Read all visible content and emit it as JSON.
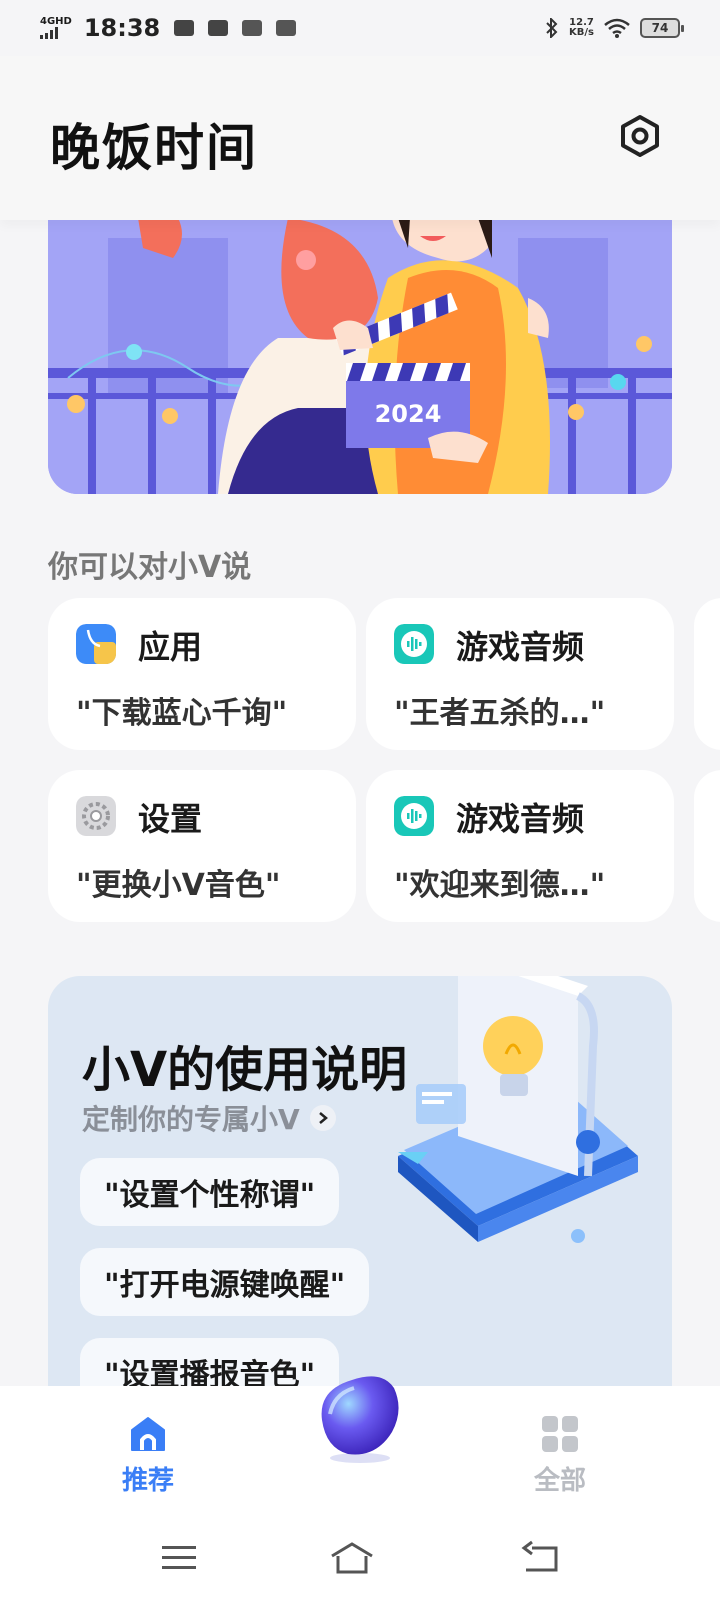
{
  "status_bar": {
    "network": "4GHD",
    "time": "18:38",
    "speed_value": "12.7",
    "speed_unit": "KB/s",
    "battery": "74"
  },
  "header": {
    "title": "晚饭时间",
    "settings_icon": "hexagon-settings-icon"
  },
  "banner": {
    "year": "2024"
  },
  "suggestions": {
    "section_title": "你可以对小V说",
    "cards": [
      {
        "name": "应用",
        "phrase": "\"下载蓝心千询\"",
        "icon": "app-icon"
      },
      {
        "name": "游戏音频",
        "phrase": "\"王者五杀的…\"",
        "icon": "audio-wave-icon"
      },
      {
        "name": "设置",
        "phrase": "\"更换小V音色\"",
        "icon": "gear-icon"
      },
      {
        "name": "游戏音频",
        "phrase": "\"欢迎来到德…\"",
        "icon": "audio-wave-icon"
      }
    ]
  },
  "guide": {
    "title": "小V的使用说明",
    "subtitle": "定制你的专属小V",
    "chips": [
      "\"设置个性称谓\"",
      "\"打开电源键唤醒\"",
      "\"设置播报音色\""
    ]
  },
  "bottom_nav": {
    "items": [
      {
        "label": "推荐",
        "icon": "home-icon",
        "active": true
      },
      {
        "label": "全部",
        "icon": "grid-icon",
        "active": false
      }
    ],
    "active_color": "#3a7ef6",
    "inactive_color": "#b9bcc2"
  }
}
